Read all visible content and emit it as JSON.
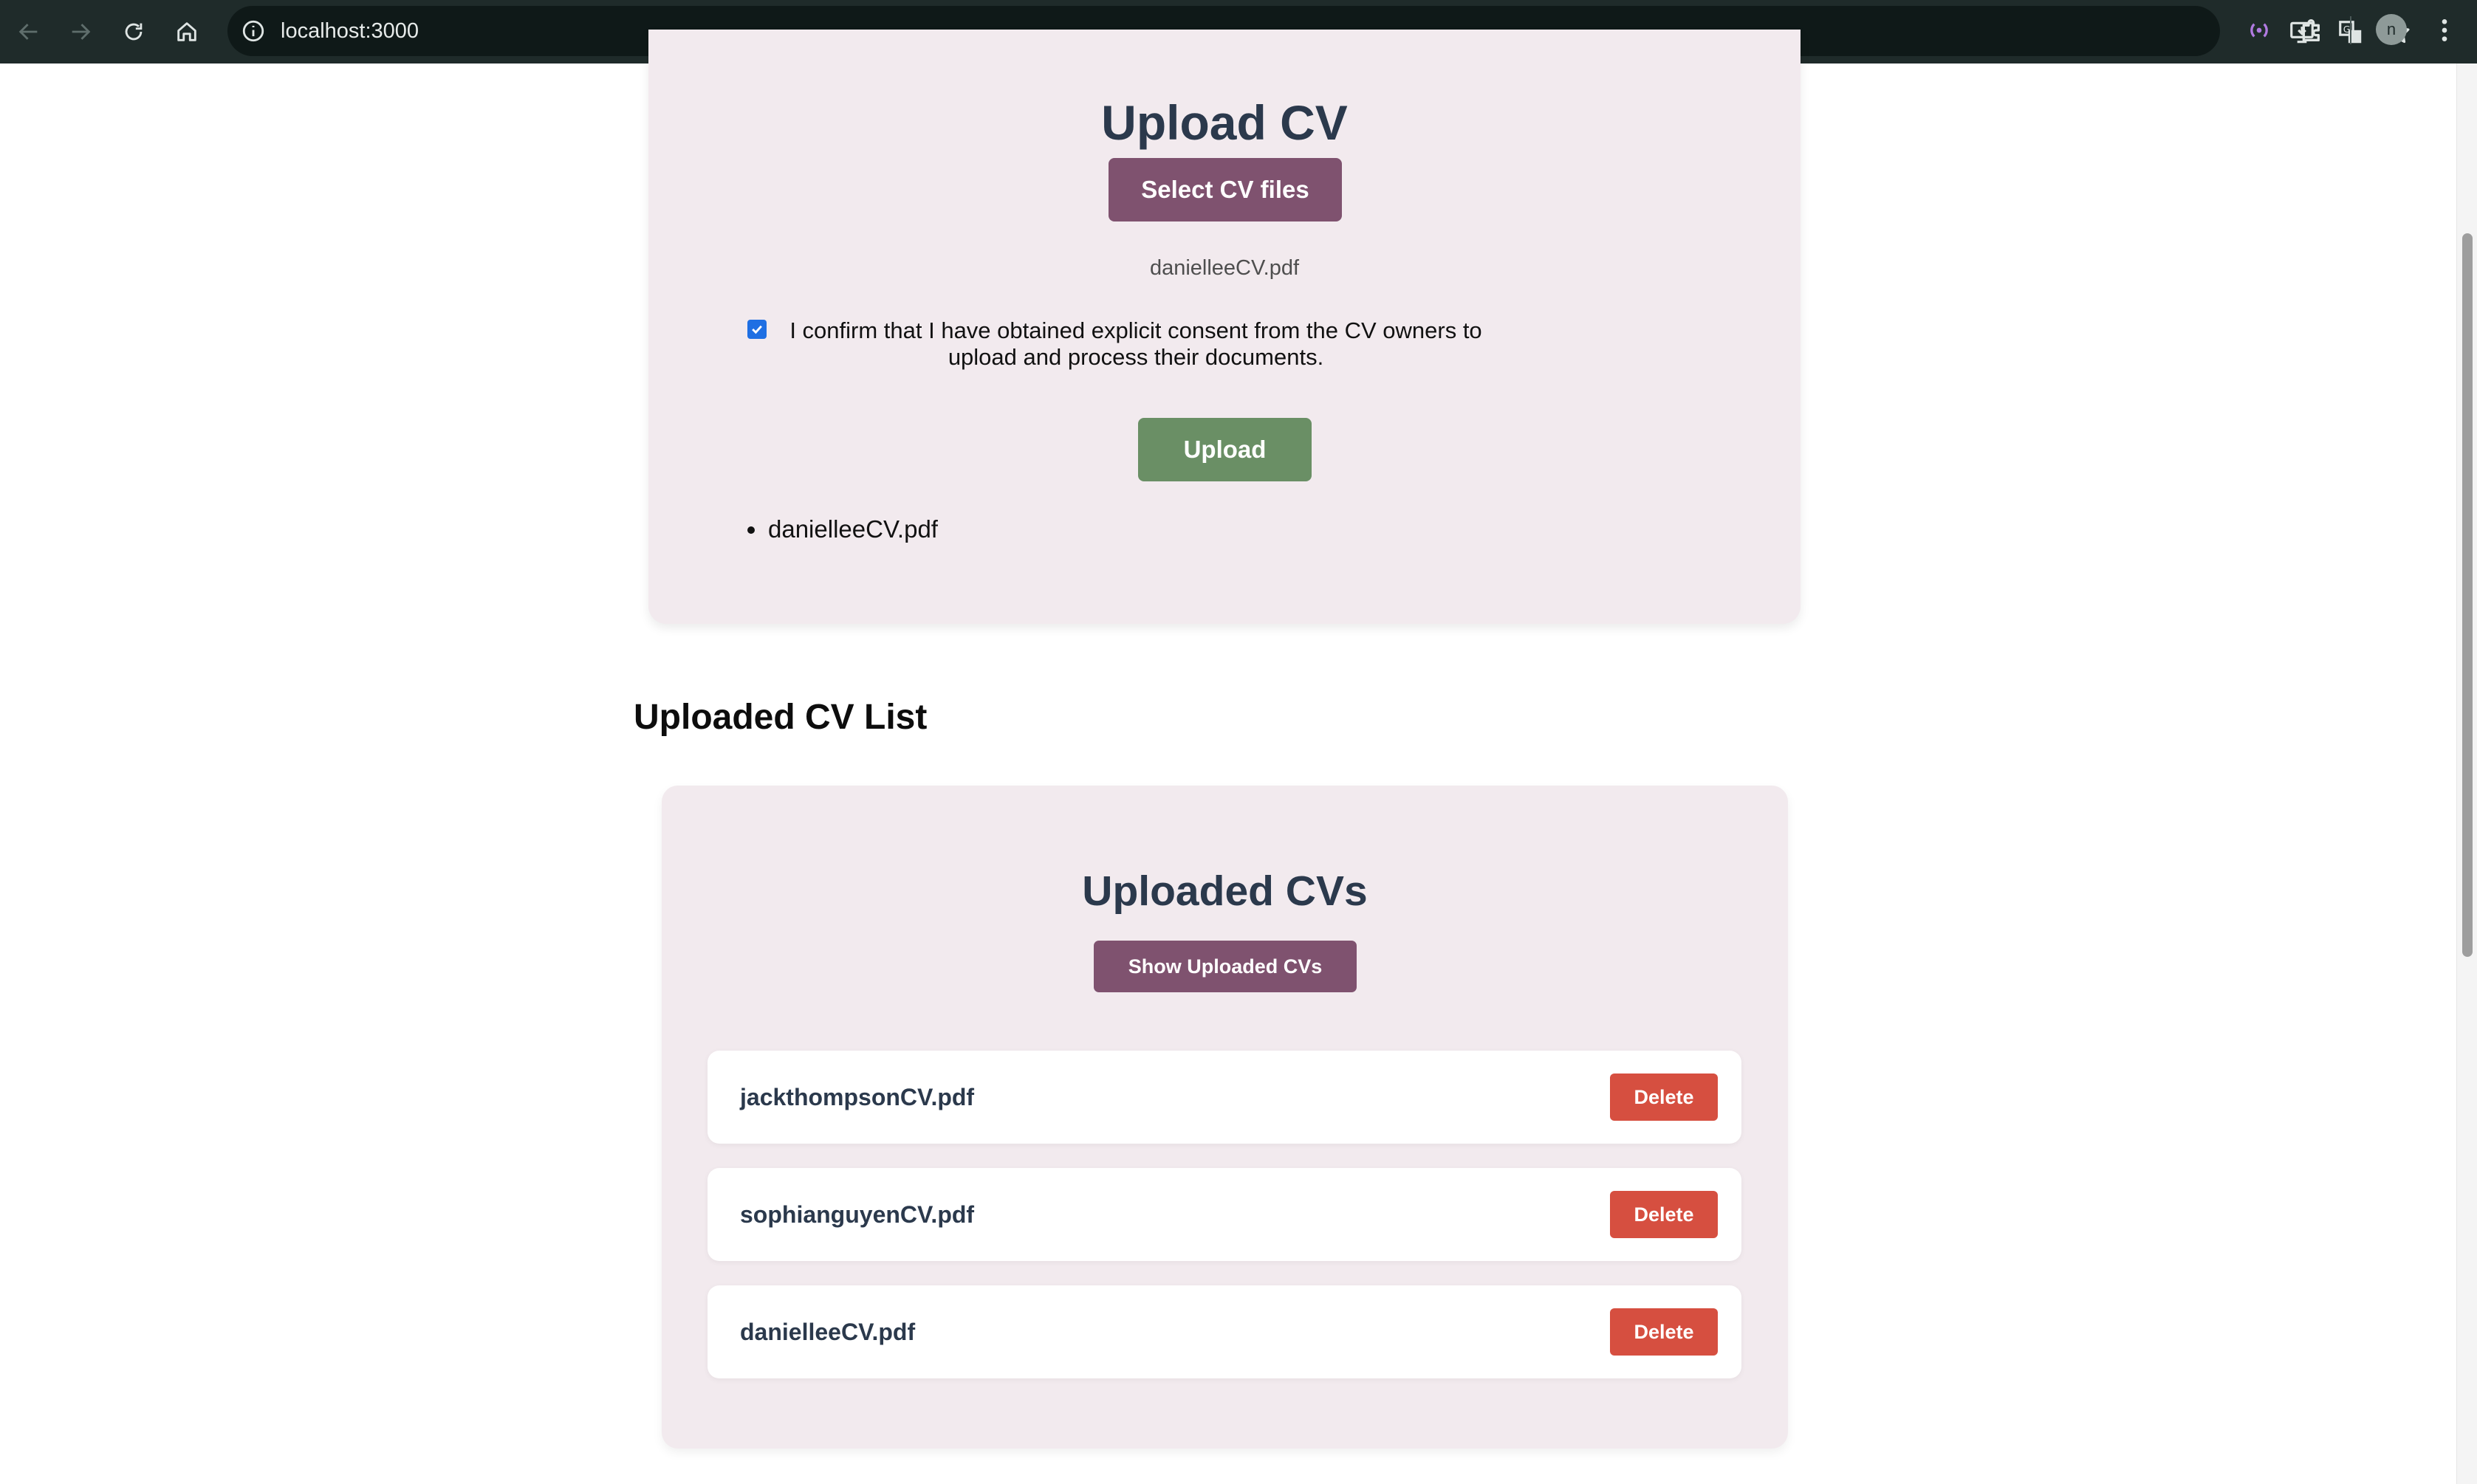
{
  "browser": {
    "url": "localhost:3000",
    "profile_initial": "n",
    "icons": [
      "back-icon",
      "forward-icon",
      "reload-icon",
      "home-icon",
      "site-info-icon",
      "install-app-icon",
      "translate-icon",
      "bookmark-star-icon",
      "extension-media-icon",
      "extensions-puzzle-icon",
      "profile-avatar",
      "menu-kebab-icon"
    ]
  },
  "upload": {
    "title": "Upload CV",
    "select_button": "Select CV files",
    "selected_file": "danielleeCV.pdf",
    "consent_checked": true,
    "consent_text": "I confirm that I have obtained explicit consent from the CV owners to upload and process their documents.",
    "upload_button": "Upload",
    "queued_files": [
      "danielleeCV.pdf"
    ]
  },
  "uploaded_section": {
    "heading": "Uploaded CV List",
    "card_title": "Uploaded CVs",
    "show_button": "Show Uploaded CVs",
    "delete_label": "Delete",
    "items": [
      {
        "name": "jackthompsonCV.pdf"
      },
      {
        "name": "sophianguyenCV.pdf"
      },
      {
        "name": "danielleeCV.pdf"
      }
    ]
  },
  "colors": {
    "chrome_bg": "#1f2b2a",
    "card_bg": "#f2eaee",
    "primary_purple": "#7f526f",
    "upload_green": "#6a8f65",
    "delete_red": "#d64f40",
    "title_navy": "#2b394c"
  }
}
